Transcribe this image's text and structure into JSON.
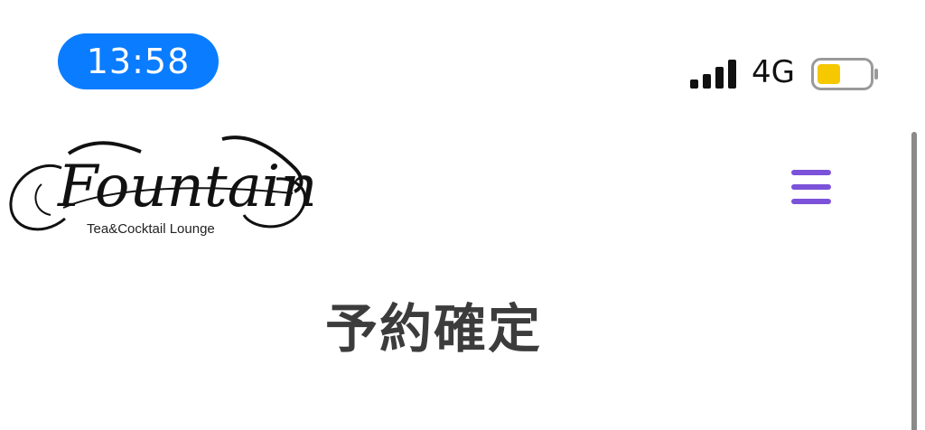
{
  "status_bar": {
    "time": "13:58",
    "network": "4G",
    "icons": {
      "signal": "cellular-signal-icon",
      "battery": "battery-icon"
    },
    "battery_level": 0.45,
    "colors": {
      "time_pill": "#0a7cff",
      "battery_fill": "#f5c800"
    }
  },
  "header": {
    "logo": {
      "name": "Fountain",
      "tagline": "Tea&Cocktail Lounge"
    },
    "menu_icon": "hamburger-menu-icon",
    "menu_color": "#7b52d9"
  },
  "main": {
    "title": "予約確定"
  }
}
